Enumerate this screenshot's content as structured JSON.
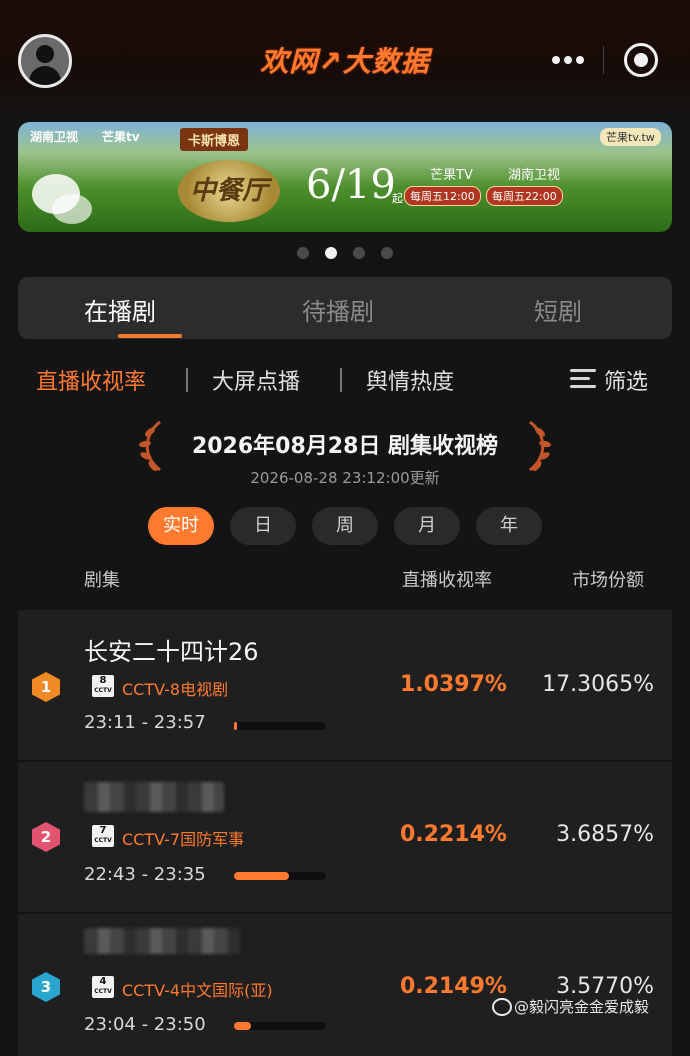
{
  "header": {
    "app_title": "欢网↗大数据",
    "avatar_icon": "user-avatar-icon",
    "more_icon": "more-dots-icon",
    "target_icon": "target-close-icon"
  },
  "banner": {
    "brand_left": "湖南卫视",
    "brand_mango": "芒果tv",
    "ribbon": "卡斯博恩",
    "show_title": "中餐厅",
    "date": "6/19",
    "date_suffix": "起",
    "channel1": "芒果TV",
    "time1": "每周五12:00",
    "channel2": "湖南卫视",
    "time2": "每周五22:00",
    "brand_right": "芒果tv.tw"
  },
  "carousel": {
    "count": 4,
    "active_index": 1
  },
  "tabs": [
    {
      "label": "在播剧",
      "active": true
    },
    {
      "label": "待播剧",
      "active": false
    },
    {
      "label": "短剧",
      "active": false
    }
  ],
  "subtabs": [
    {
      "label": "直播收视率",
      "active": true
    },
    {
      "label": "大屏点播",
      "active": false
    },
    {
      "label": "舆情热度",
      "active": false
    }
  ],
  "filter": {
    "label": "筛选",
    "icon": "filter-list-icon"
  },
  "ranking": {
    "title": "2026年08月28日 剧集收视榜",
    "updated": "2026-08-28 23:12:00更新"
  },
  "periods": [
    {
      "label": "实时",
      "active": true
    },
    {
      "label": "日",
      "active": false
    },
    {
      "label": "周",
      "active": false
    },
    {
      "label": "月",
      "active": false
    },
    {
      "label": "年",
      "active": false
    }
  ],
  "columns": {
    "show": "剧集",
    "rating": "直播收视率",
    "share": "市场份额"
  },
  "rows": [
    {
      "rank": "1",
      "badge_color": "#f08a24",
      "name": "长安二十四计26",
      "name_visible": true,
      "channel_num": "8",
      "channel": "CCTV-8电视剧",
      "rating": "1.0397%",
      "share": "17.3065%",
      "time": "23:11 - 23:57",
      "progress": 0.02
    },
    {
      "rank": "2",
      "badge_color": "#e2536f",
      "name": "",
      "name_visible": false,
      "channel_num": "7",
      "channel": "CCTV-7国防军事",
      "rating": "0.2214%",
      "share": "3.6857%",
      "time": "22:43 - 23:35",
      "progress": 0.6
    },
    {
      "rank": "3",
      "badge_color": "#28a6cf",
      "name": "",
      "name_visible": false,
      "channel_num": "4",
      "channel": "CCTV-4中文国际(亚)",
      "rating": "0.2149%",
      "share": "3.5770%",
      "time": "23:04 - 23:50",
      "progress": 0.18
    }
  ],
  "watermark": {
    "text": "@毅闪亮金金爱成毅",
    "icon": "weibo-icon"
  }
}
